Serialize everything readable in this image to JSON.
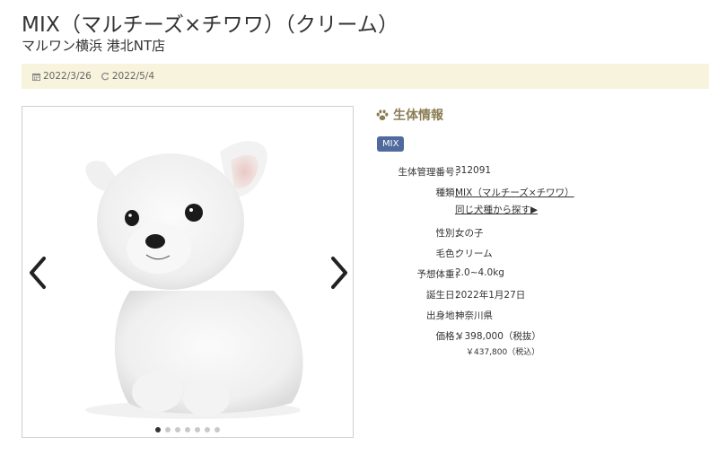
{
  "page": {
    "title": "MIX（マルチーズ×チワワ）（クリーム）",
    "subtitle": "マルワン横浜 港北NT店"
  },
  "dates": {
    "posted": "2022/3/26",
    "updated": "2022/5/4"
  },
  "gallery": {
    "dot_count": 7,
    "active_dot": 1
  },
  "info": {
    "heading": "生体情報",
    "tag": "MIX",
    "rows": [
      {
        "label": "生体管理番号：",
        "value": "312091"
      },
      {
        "label": "種類：",
        "value": "MIX（マルチーズ×チワワ）",
        "link2": "同じ犬種から探す▶"
      },
      {
        "label": "性別：",
        "value": "女の子"
      },
      {
        "label": "毛色：",
        "value": "クリーム"
      },
      {
        "label": "予想体重：",
        "value": "2.0~4.0kg"
      },
      {
        "label": "誕生日：",
        "value": "2022年1月27日"
      },
      {
        "label": "出身地：",
        "value": "神奈川県"
      },
      {
        "label": "価格：",
        "value": "￥398,000（税抜）",
        "sub": "￥437,800（税込）"
      }
    ]
  },
  "colors": {
    "accent": "#8b7d55",
    "tag": "#4f6a9c",
    "datebar": "#f7f3dc"
  }
}
